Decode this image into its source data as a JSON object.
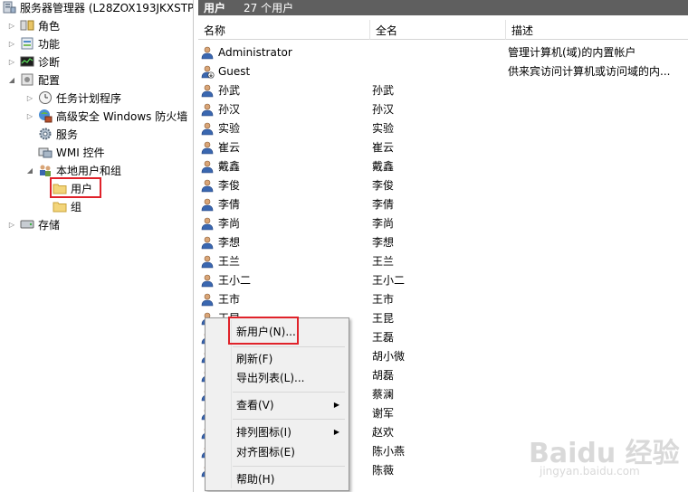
{
  "tree": {
    "root": "服务器管理器 (L28ZOX193JKXSTP",
    "nodes": [
      {
        "label": "角色"
      },
      {
        "label": "功能"
      },
      {
        "label": "诊断"
      },
      {
        "label": "配置"
      },
      {
        "label": "任务计划程序"
      },
      {
        "label": "高级安全 Windows 防火墙"
      },
      {
        "label": "服务"
      },
      {
        "label": "WMI 控件"
      },
      {
        "label": "本地用户和组"
      },
      {
        "label": "用户"
      },
      {
        "label": "组"
      },
      {
        "label": "存储"
      }
    ]
  },
  "pane": {
    "title": "用户",
    "count": "27 个用户",
    "columns": [
      "名称",
      "全名",
      "描述"
    ],
    "rows": [
      {
        "name": "Administrator",
        "full": "",
        "desc": "管理计算机(域)的内置帐户"
      },
      {
        "name": "Guest",
        "full": "",
        "desc": "供来宾访问计算机或访问域的内..."
      },
      {
        "name": "孙武",
        "full": "孙武",
        "desc": ""
      },
      {
        "name": "孙汉",
        "full": "孙汉",
        "desc": ""
      },
      {
        "name": "实验",
        "full": "实验",
        "desc": ""
      },
      {
        "name": "崔云",
        "full": "崔云",
        "desc": ""
      },
      {
        "name": "戴鑫",
        "full": "戴鑫",
        "desc": ""
      },
      {
        "name": "李俊",
        "full": "李俊",
        "desc": ""
      },
      {
        "name": "李倩",
        "full": "李倩",
        "desc": ""
      },
      {
        "name": "李尚",
        "full": "李尚",
        "desc": ""
      },
      {
        "name": "李想",
        "full": "李想",
        "desc": ""
      },
      {
        "name": "王兰",
        "full": "王兰",
        "desc": ""
      },
      {
        "name": "王小二",
        "full": "王小二",
        "desc": ""
      },
      {
        "name": "王市",
        "full": "王市",
        "desc": ""
      },
      {
        "name": "王昆",
        "full": "王昆",
        "desc": ""
      },
      {
        "name": "",
        "full": "王磊",
        "desc": ""
      },
      {
        "name": "",
        "full": "胡小微",
        "desc": ""
      },
      {
        "name": "",
        "full": "胡磊",
        "desc": ""
      },
      {
        "name": "",
        "full": "蔡澜",
        "desc": ""
      },
      {
        "name": "",
        "full": "谢军",
        "desc": ""
      },
      {
        "name": "",
        "full": "赵欢",
        "desc": ""
      },
      {
        "name": "",
        "full": "陈小燕",
        "desc": ""
      },
      {
        "name": "",
        "full": "陈薇",
        "desc": ""
      }
    ]
  },
  "menu": {
    "items": [
      {
        "label": "新用户(N)..."
      },
      {
        "label": "刷新(F)"
      },
      {
        "label": "导出列表(L)..."
      },
      {
        "label": "查看(V)"
      },
      {
        "label": "排列图标(I)"
      },
      {
        "label": "对齐图标(E)"
      },
      {
        "label": "帮助(H)"
      }
    ]
  },
  "watermark": {
    "brand": "Baidu 经验",
    "url": "jingyan.baidu.com"
  },
  "colors": {
    "header_bg": "#5f5f5f",
    "highlight": "#e0222a",
    "menu_bg": "#f0f0f0"
  }
}
